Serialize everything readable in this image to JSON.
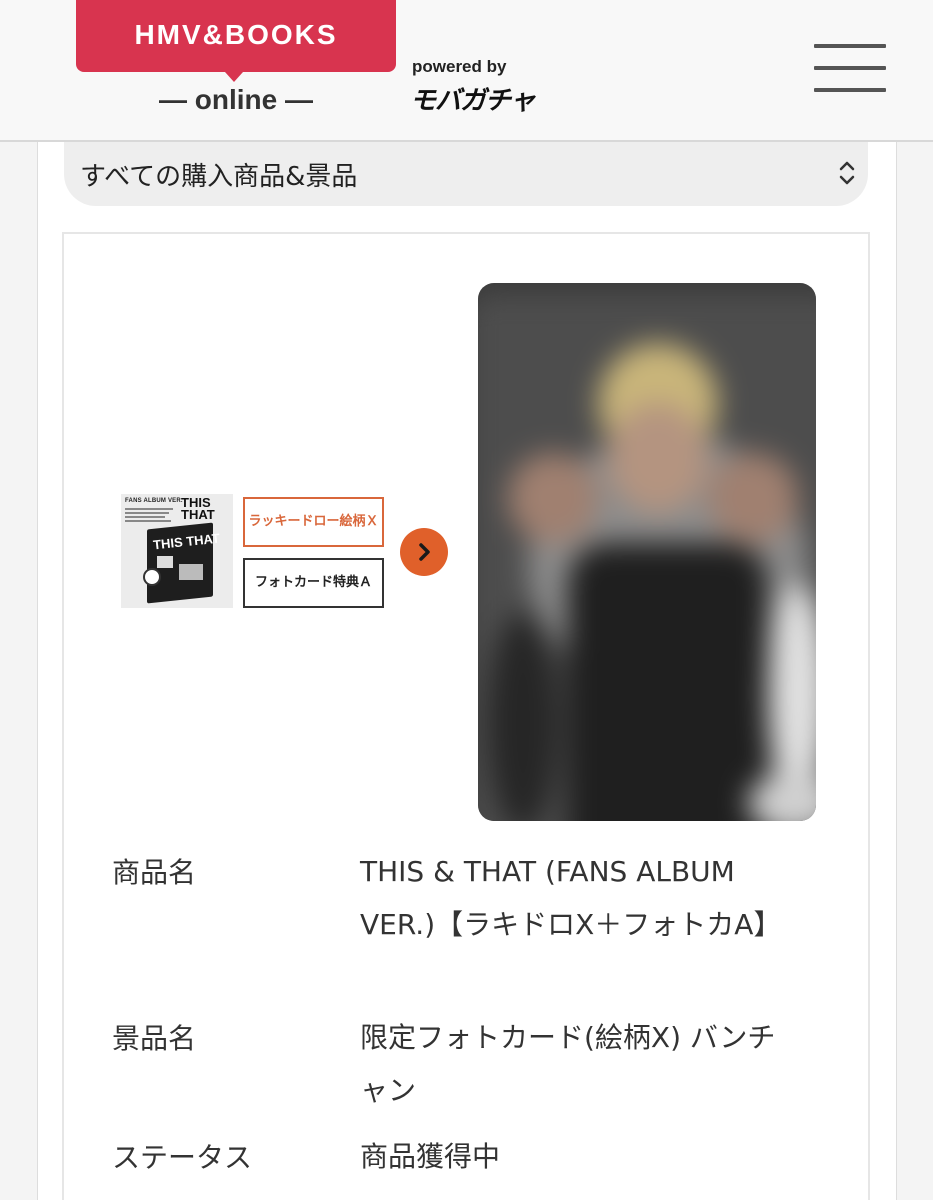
{
  "header": {
    "logo_text": "HMV&BOOKS",
    "logo_sub": "— online —",
    "powered_by": "powered by",
    "brand": "モバガチャ",
    "menu_icon": "hamburger-menu-icon"
  },
  "filter": {
    "selected": "すべての購入商品&景品",
    "icon": "updown-chevron-icon"
  },
  "item": {
    "album_thumb": {
      "header": "FANS ALBUM VER.",
      "title": "THIS THAT",
      "box_title": "THIS THAT"
    },
    "tags": {
      "lucky": "ラッキードロー絵柄Ｘ",
      "photo": "フォトカード特典Ａ"
    },
    "arrow_icon": "chevron-right-icon",
    "rows": [
      {
        "label": "商品名",
        "value": "THIS & THAT (FANS ALBUM VER.)【ラキドロX＋フォトカA】"
      },
      {
        "label": "景品名",
        "value": "限定フォトカード(絵柄X) バンチャン"
      },
      {
        "label": "ステータス",
        "value": "商品獲得中"
      }
    ]
  },
  "colors": {
    "brand_red": "#d8344f",
    "accent_orange": "#e0602a",
    "tag_orange": "#d9673b"
  }
}
